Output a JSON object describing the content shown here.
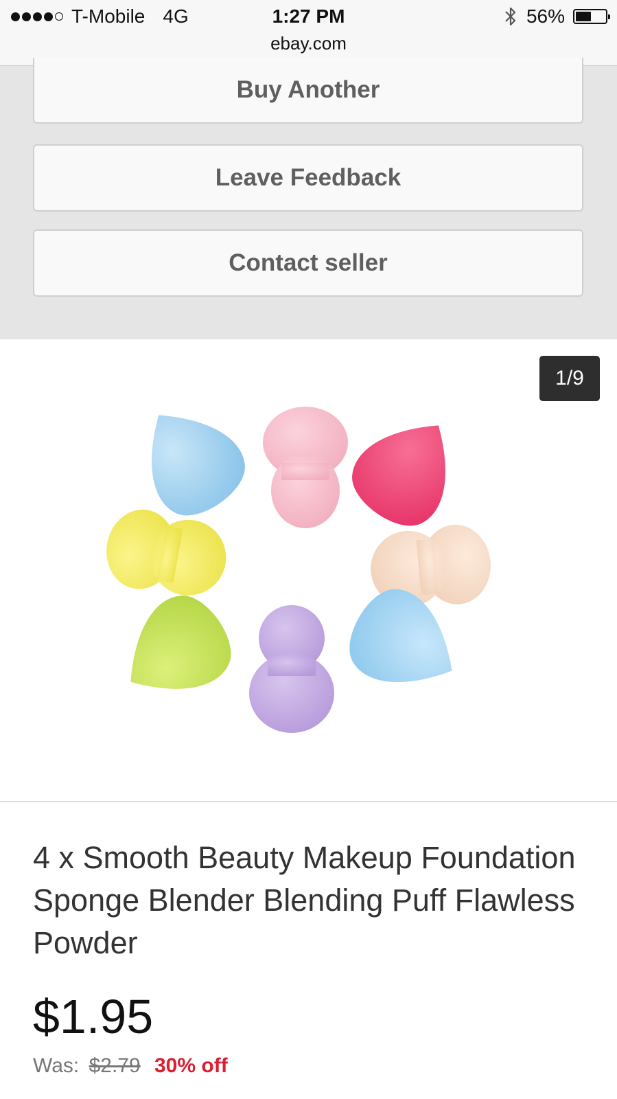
{
  "status_bar": {
    "carrier": "T-Mobile",
    "network": "4G",
    "time": "1:27 PM",
    "url": "ebay.com",
    "battery": "56%",
    "battery_level": 0.56,
    "signal_bars_filled": 4,
    "signal_bars_total": 5,
    "icons": [
      "signal-dots-icon",
      "bluetooth-icon",
      "battery-icon"
    ]
  },
  "actions": {
    "buy_another": "Buy Another",
    "leave_feedback": "Leave Feedback",
    "contact_seller": "Contact seller"
  },
  "gallery": {
    "counter": "1/9",
    "image_icon": "makeup-sponges-image"
  },
  "product": {
    "title": "4 x Smooth Beauty Makeup Foundation Sponge Blender Blending Puff Flawless Powder",
    "price": "$1.95",
    "was_label": "Was:",
    "was_price": "$2.79",
    "discount": "30% off"
  },
  "colors": {
    "accent_discount": "#dd1e31",
    "action_background": "#e5e5e5",
    "counter_background": "#2e2e2e"
  }
}
